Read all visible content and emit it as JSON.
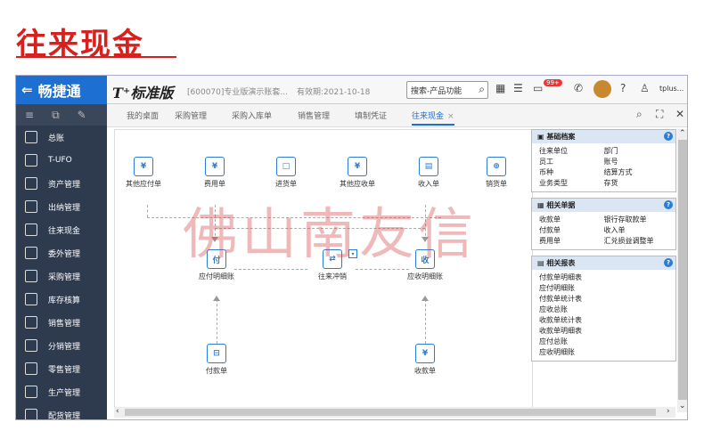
{
  "banner": {
    "title": "往来现金"
  },
  "header": {
    "brand": "畅捷通",
    "edition": "T⁺标准版",
    "account": "[600070]专业版演示账套...",
    "valid": "有效期:2021-10-18",
    "search_placeholder": "搜索-产品功能",
    "badge": "99+",
    "user": "tplus..."
  },
  "sidebar": {
    "items": [
      {
        "label": "总账"
      },
      {
        "label": "T-UFO"
      },
      {
        "label": "资产管理"
      },
      {
        "label": "出纳管理"
      },
      {
        "label": "往来现金"
      },
      {
        "label": "委外管理"
      },
      {
        "label": "采购管理"
      },
      {
        "label": "库存核算"
      },
      {
        "label": "销售管理"
      },
      {
        "label": "分销管理"
      },
      {
        "label": "零售管理"
      },
      {
        "label": "生产管理"
      },
      {
        "label": "配货管理"
      }
    ]
  },
  "tabs": [
    {
      "label": "我的桌面"
    },
    {
      "label": "采购管理"
    },
    {
      "label": "采购入库单"
    },
    {
      "label": "销售管理"
    },
    {
      "label": "填制凭证"
    },
    {
      "label": "往来现金"
    }
  ],
  "flow": {
    "top_nodes": [
      {
        "label": "其他应付单",
        "icon": "¥"
      },
      {
        "label": "费用单",
        "icon": "¥"
      },
      {
        "label": "进货单",
        "icon": "□"
      },
      {
        "label": "其他应收单",
        "icon": "¥"
      },
      {
        "label": "收入单",
        "icon": "▤"
      },
      {
        "label": "销货单",
        "icon": "⊕"
      }
    ],
    "payable_detail": "应付明细账",
    "offset": "往来冲销",
    "receivable_detail": "应收明细账",
    "payment": "付款单",
    "receipt": "收款单"
  },
  "watermark": "佛山南友信",
  "panels": {
    "basic": {
      "title": "基础档案",
      "items": [
        "往来单位",
        "部门",
        "员工",
        "账号",
        "币种",
        "结算方式",
        "业务类型",
        "存货"
      ]
    },
    "docs": {
      "title": "相关单据",
      "items": [
        "收款单",
        "银行存取款单",
        "付款单",
        "收入单",
        "费用单",
        "汇兑损益调整单"
      ]
    },
    "reports": {
      "title": "相关报表",
      "items": [
        "付款单明细表",
        "应付明细账",
        "付款单统计表",
        "应收总账",
        "收款单统计表",
        "收款单明细表",
        "应付总账",
        "应收明细账"
      ]
    }
  }
}
